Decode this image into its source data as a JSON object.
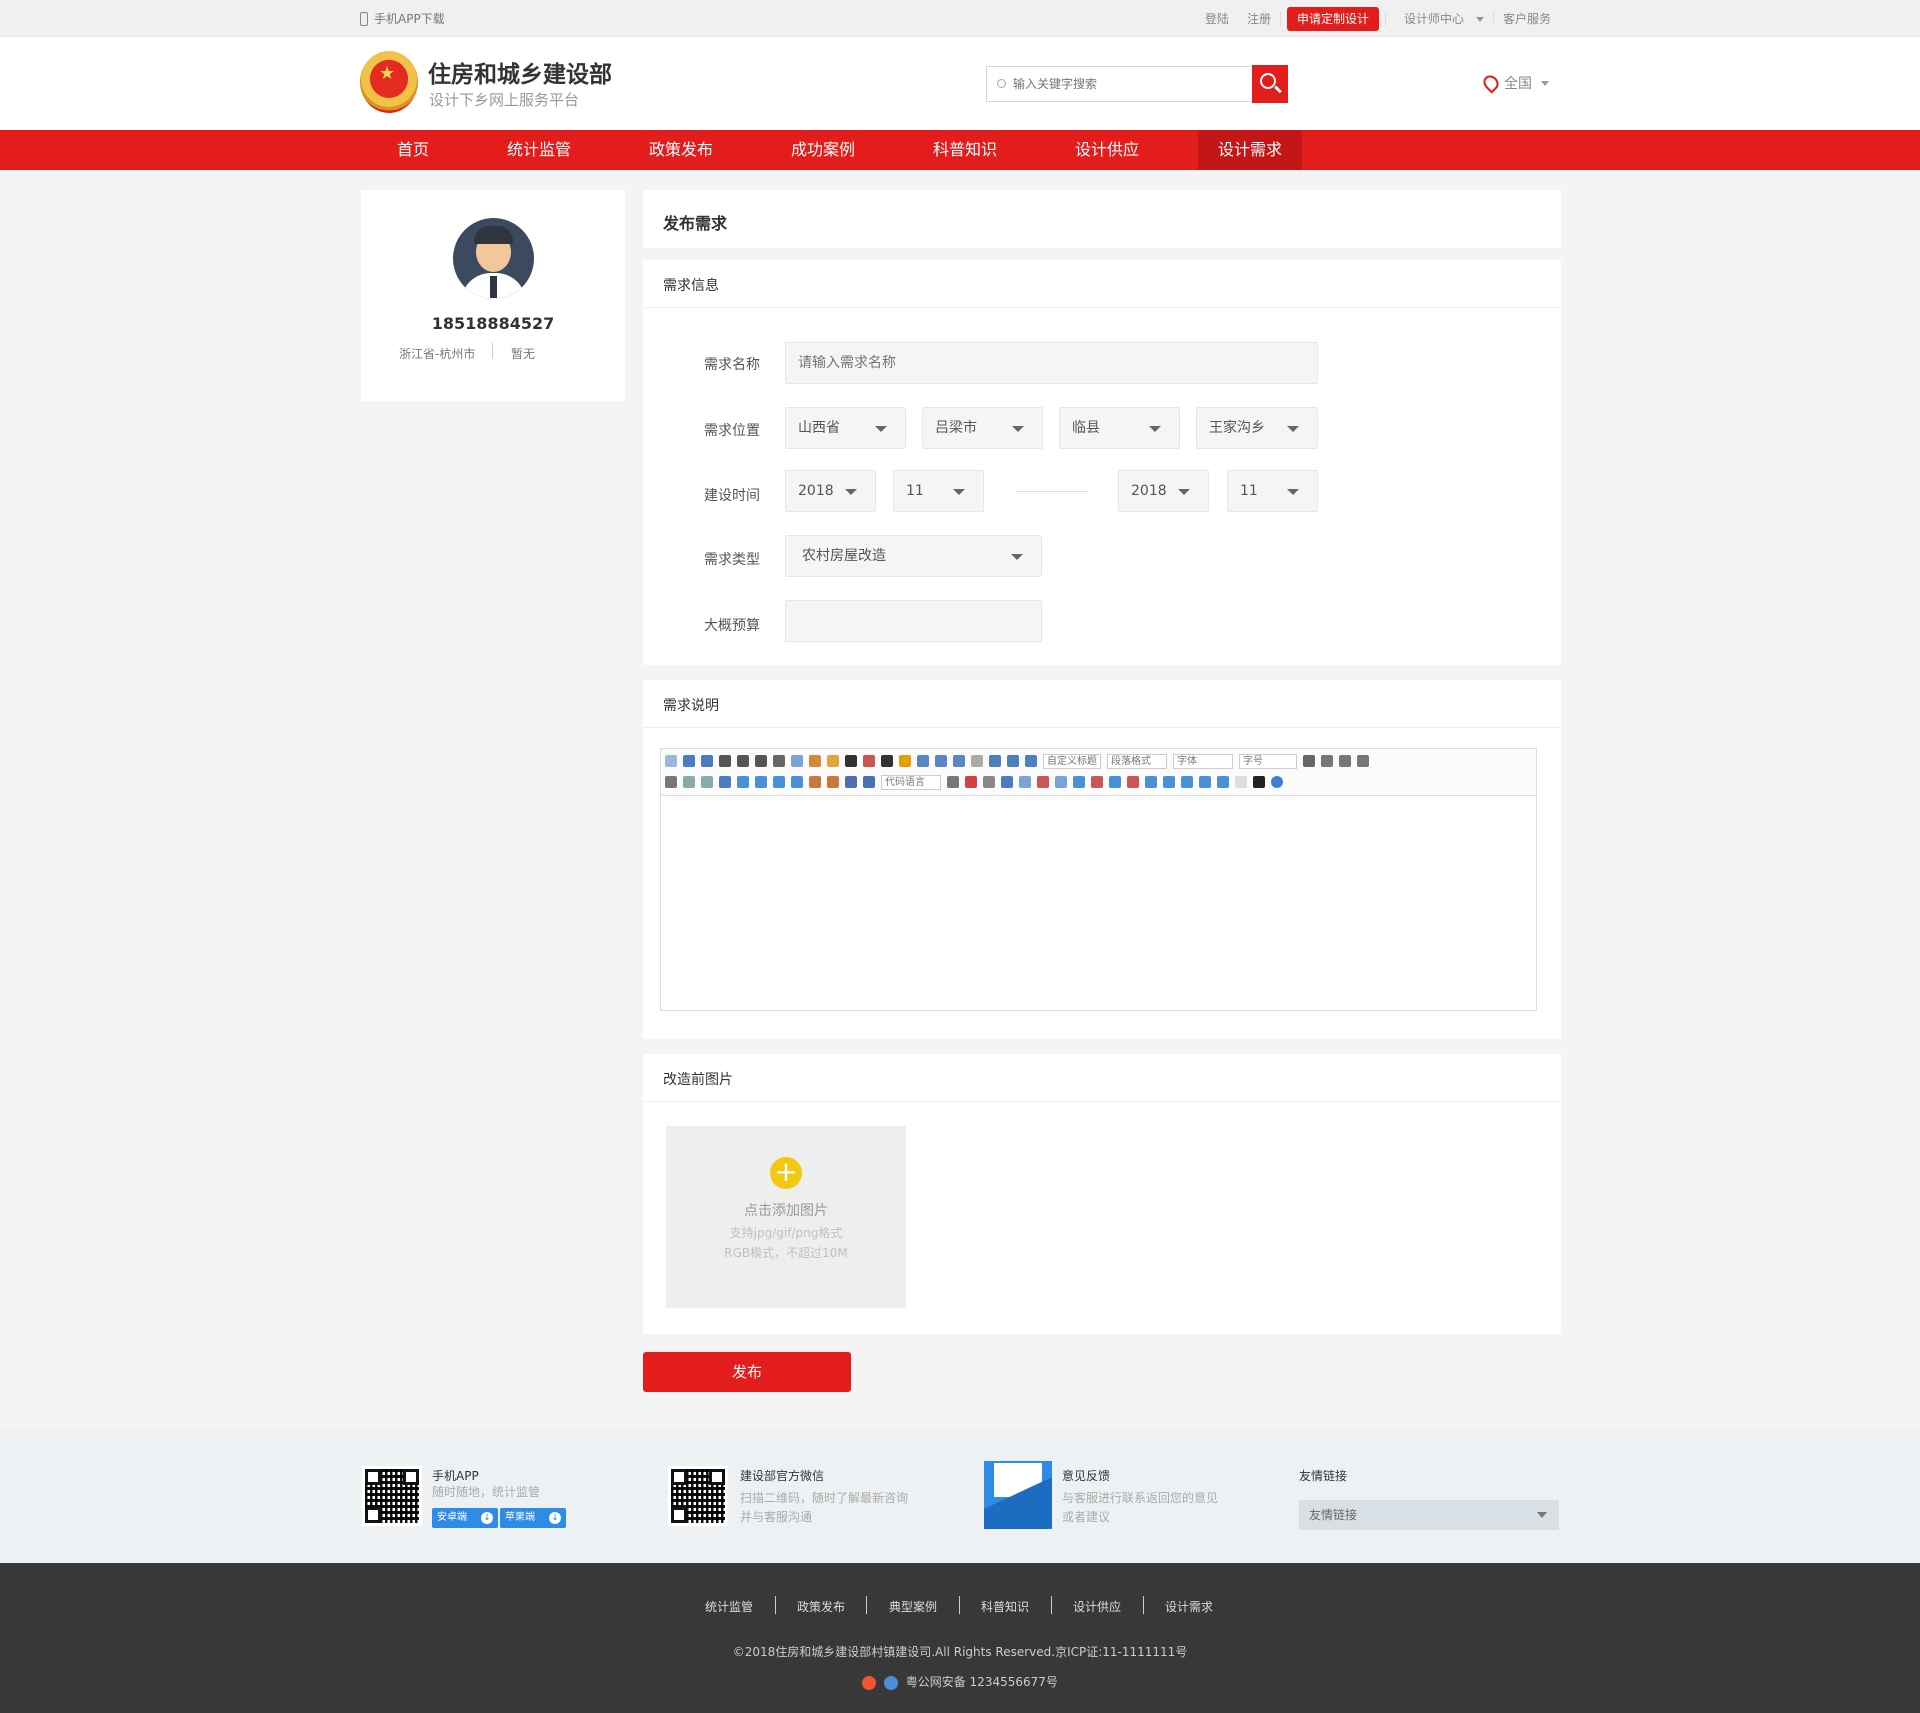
{
  "topbar": {
    "app_download": "手机APP下载",
    "login": "登陆",
    "register": "注册",
    "apply_custom": "申请定制设计",
    "designer_center": "设计师中心",
    "customer_service": "客户服务"
  },
  "header": {
    "site_title": "住房和城乡建设部",
    "site_subtitle": "设计下乡网上服务平台",
    "search_placeholder": "输入关键字搜索",
    "region": "全国"
  },
  "nav": {
    "items": [
      {
        "label": "首页"
      },
      {
        "label": "统计监管"
      },
      {
        "label": "政策发布"
      },
      {
        "label": "成功案例"
      },
      {
        "label": "科普知识"
      },
      {
        "label": "设计供应"
      },
      {
        "label": "设计需求"
      }
    ],
    "active_index": 6
  },
  "profile": {
    "phone": "18518884527",
    "location": "浙江省-杭州市",
    "status": "暂无"
  },
  "form": {
    "page_title": "发布需求",
    "section_info": "需求信息",
    "name_label": "需求名称",
    "name_placeholder": "请输入需求名称",
    "location_label": "需求位置",
    "province": "山西省",
    "city": "吕梁市",
    "county": "临县",
    "town": "王家沟乡",
    "time_label": "建设时间",
    "start_year": "2018",
    "start_month": "11",
    "end_year": "2018",
    "end_month": "11",
    "type_label": "需求类型",
    "type_value": "农村房屋改造",
    "budget_label": "大概预算",
    "budget_value": ""
  },
  "description": {
    "section_title": "需求说明",
    "toolbar_selects": [
      "自定义标题",
      "段落格式",
      "字体",
      "字号"
    ],
    "code_language": "代码语言"
  },
  "images": {
    "section_title": "改造前图片",
    "add_label": "点击添加图片",
    "hint_formats": "支持jpg/gif/png格式",
    "hint_size": "RGB模式，不超过10M"
  },
  "publish_label": "发布",
  "footer": {
    "app_title": "手机APP",
    "app_desc": "随时随地，统计监管",
    "android": "安卓端",
    "ios": "苹果端",
    "wechat_title": "建设部官方微信",
    "wechat_desc1": "扫描二维码，随时了解最新咨询",
    "wechat_desc2": "并与客服沟通",
    "feedback_title": "意见反馈",
    "feedback_desc1": "与客服进行联系返回您的意见",
    "feedback_desc2": "或者建议",
    "links_title": "友情链接",
    "links_select": "友情链接",
    "bottom_nav": [
      "统计监管",
      "政策发布",
      "典型案例",
      "科普知识",
      "设计供应",
      "设计需求"
    ],
    "copyright": "©2018住房和城乡建设部村镇建设司.All Rights Reserved.京ICP证:11-1111111号",
    "police": "粤公网安备 1234556677号"
  },
  "colors": {
    "brand_red": "#e31c1c",
    "accent_yellow": "#f2c811",
    "footer_dark": "#383838"
  }
}
